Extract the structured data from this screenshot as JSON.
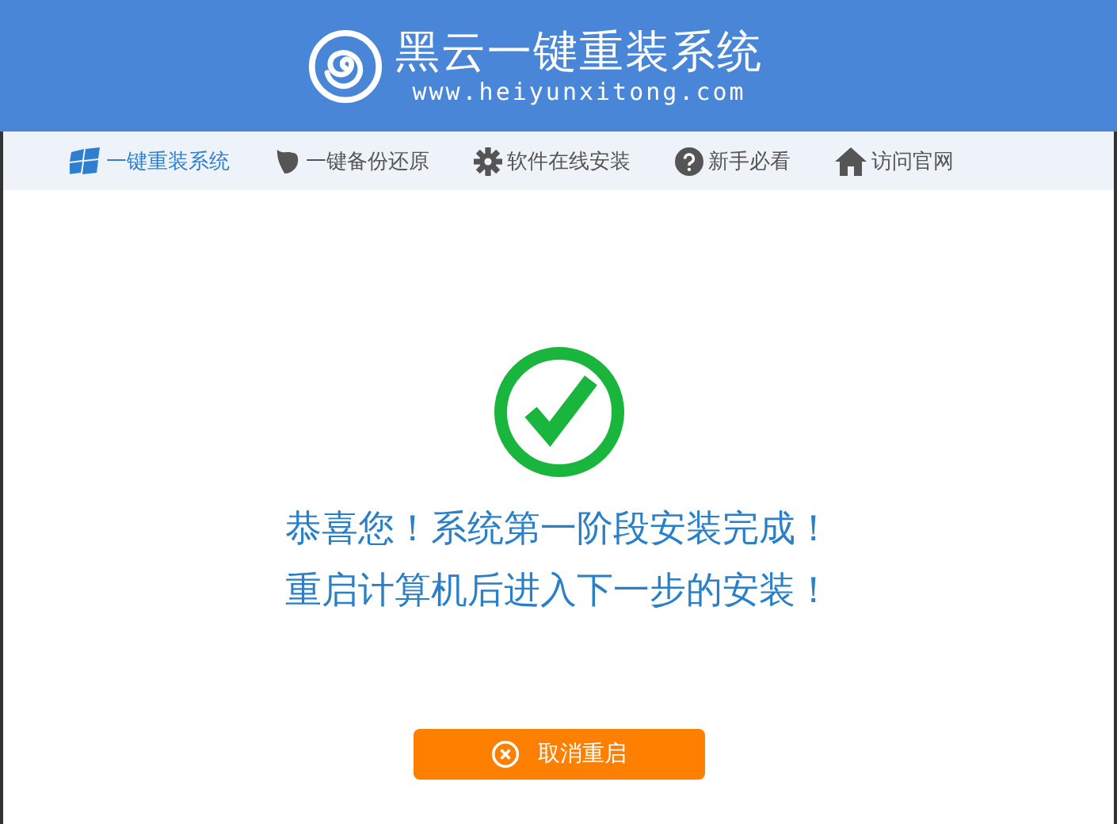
{
  "header": {
    "title": "黑云一键重装系统",
    "url": "www.heiyunxitong.com"
  },
  "nav": [
    {
      "label": "一键重装系统",
      "selected": true
    },
    {
      "label": "一键备份还原",
      "selected": false
    },
    {
      "label": "软件在线安装",
      "selected": false
    },
    {
      "label": "新手必看",
      "selected": false
    },
    {
      "label": "访问官网",
      "selected": false
    }
  ],
  "message": [
    "恭喜您！系统第一阶段安装完成！",
    "重启计算机后进入下一步的安装！"
  ],
  "cancel_button": {
    "label": "取消重启"
  }
}
